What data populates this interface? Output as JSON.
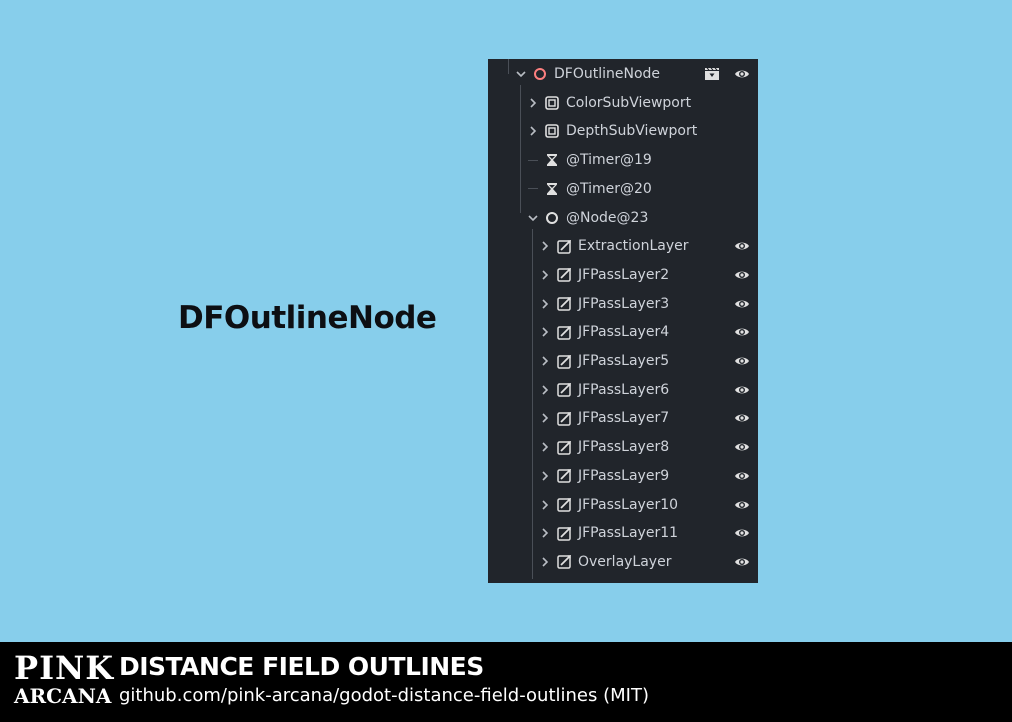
{
  "heading": "DFOutlineNode",
  "colors": {
    "background": "#87ceeb",
    "panel": "#21252b",
    "text": "#cfd3da",
    "outline_node_icon": "#fc7f7f",
    "icon": "#e0e0e0"
  },
  "tree": {
    "nodes": [
      {
        "label": "DFOutlineNode",
        "icon": "node-icon",
        "expanded": true,
        "depth": 0,
        "visibility": true,
        "scene": true
      },
      {
        "label": "ColorSubViewport",
        "icon": "subviewport-icon",
        "expanded": false,
        "depth": 1,
        "visibility": false
      },
      {
        "label": "DepthSubViewport",
        "icon": "subviewport-icon",
        "expanded": false,
        "depth": 1,
        "visibility": false
      },
      {
        "label": "@Timer@19",
        "icon": "timer-icon",
        "depth": 1,
        "visibility": false
      },
      {
        "label": "@Timer@20",
        "icon": "timer-icon",
        "depth": 1,
        "visibility": false
      },
      {
        "label": "@Node@23",
        "icon": "node-icon",
        "expanded": true,
        "depth": 1,
        "visibility": false
      },
      {
        "label": "ExtractionLayer",
        "icon": "sprite-icon",
        "expanded": false,
        "depth": 2,
        "visibility": true
      },
      {
        "label": "JFPassLayer2",
        "icon": "sprite-icon",
        "expanded": false,
        "depth": 2,
        "visibility": true
      },
      {
        "label": "JFPassLayer3",
        "icon": "sprite-icon",
        "expanded": false,
        "depth": 2,
        "visibility": true
      },
      {
        "label": "JFPassLayer4",
        "icon": "sprite-icon",
        "expanded": false,
        "depth": 2,
        "visibility": true
      },
      {
        "label": "JFPassLayer5",
        "icon": "sprite-icon",
        "expanded": false,
        "depth": 2,
        "visibility": true
      },
      {
        "label": "JFPassLayer6",
        "icon": "sprite-icon",
        "expanded": false,
        "depth": 2,
        "visibility": true
      },
      {
        "label": "JFPassLayer7",
        "icon": "sprite-icon",
        "expanded": false,
        "depth": 2,
        "visibility": true
      },
      {
        "label": "JFPassLayer8",
        "icon": "sprite-icon",
        "expanded": false,
        "depth": 2,
        "visibility": true
      },
      {
        "label": "JFPassLayer9",
        "icon": "sprite-icon",
        "expanded": false,
        "depth": 2,
        "visibility": true
      },
      {
        "label": "JFPassLayer10",
        "icon": "sprite-icon",
        "expanded": false,
        "depth": 2,
        "visibility": true
      },
      {
        "label": "JFPassLayer11",
        "icon": "sprite-icon",
        "expanded": false,
        "depth": 2,
        "visibility": true
      },
      {
        "label": "OverlayLayer",
        "icon": "sprite-icon",
        "expanded": false,
        "depth": 2,
        "visibility": true
      }
    ]
  },
  "footer": {
    "logo_line1": "PINK",
    "logo_line2": "ARCANA",
    "title": "DISTANCE FIELD OUTLINES",
    "subtitle": "github.com/pink-arcana/godot-distance-field-outlines (MIT)"
  }
}
